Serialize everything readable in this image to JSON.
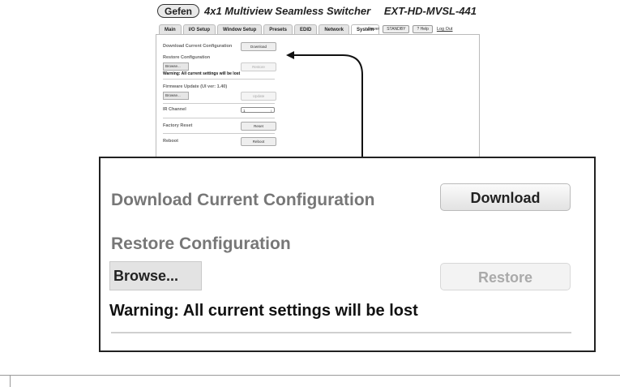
{
  "header": {
    "logo": "Gefen",
    "title": "4x1 Multiview Seamless Switcher",
    "model": "EXT-HD-MVSL-441"
  },
  "tabs": [
    {
      "label": "Main",
      "active": false
    },
    {
      "label": "I/O Setup",
      "active": false
    },
    {
      "label": "Window Setup",
      "active": false
    },
    {
      "label": "Presets",
      "active": false
    },
    {
      "label": "EDID",
      "active": false
    },
    {
      "label": "Network",
      "active": false
    },
    {
      "label": "System",
      "active": true
    }
  ],
  "topbar": {
    "power_label": "Power",
    "standby_label": "STANDBY",
    "help_label": "? Help",
    "logout_label": "Log Out"
  },
  "system": {
    "download_label": "Download Current Configuration",
    "download_button": "Download",
    "restore_label": "Restore Configuration",
    "browse_button": "Browse...",
    "restore_button": "Restore",
    "warning": "Warning: All current settings will be lost",
    "firmware_label": "Firmware Update (UI ver: 1.40)",
    "update_button": "Update",
    "ir_label": "IR Channel",
    "ir_value": "1",
    "factory_label": "Factory Reset",
    "reset_button": "Reset",
    "reboot_label": "Reboot",
    "reboot_button": "Reboot"
  },
  "colors": {
    "border": "#222222",
    "label_gray": "#777777",
    "text_dark": "#111111"
  }
}
